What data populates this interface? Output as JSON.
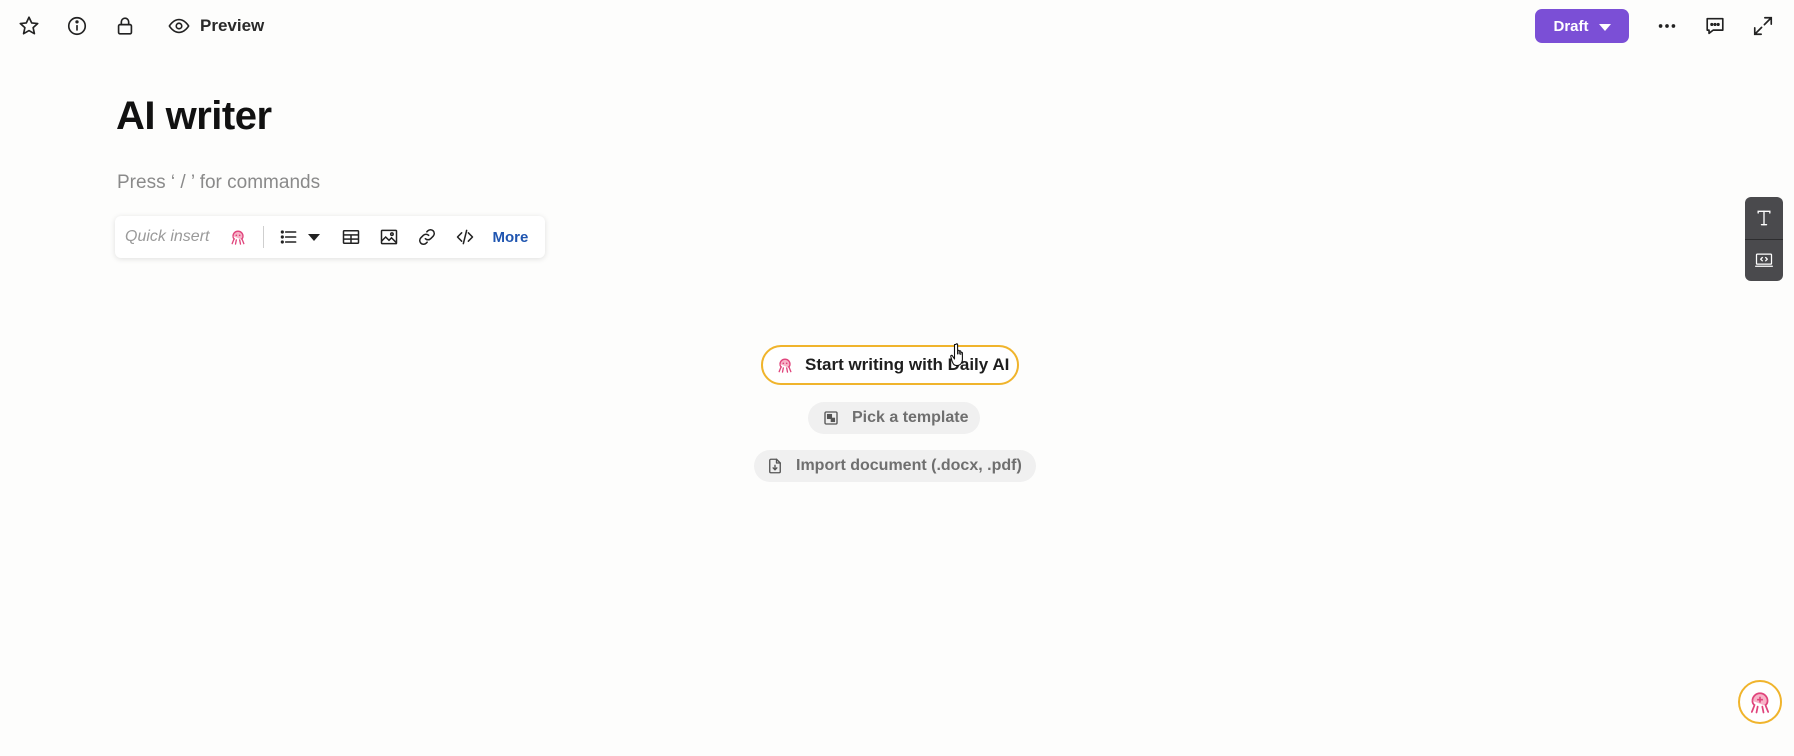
{
  "header": {
    "preview_label": "Preview",
    "draft_label": "Draft",
    "icons": [
      "star-icon",
      "info-icon",
      "lock-icon",
      "eye-icon",
      "more-horizontal-icon",
      "comment-icon",
      "expand-icon"
    ]
  },
  "document": {
    "title": "AI writer",
    "hint": "Press ‘ / ’ for commands"
  },
  "quick_insert": {
    "label": "Quick insert",
    "more_label": "More",
    "icons": [
      "octopus-ai-icon",
      "bulleted-list-icon",
      "table-icon",
      "image-icon",
      "link-icon",
      "code-icon"
    ]
  },
  "actions": {
    "ai_start_label": "Start writing with Daily AI",
    "template_label": "Pick a template",
    "import_label": "Import document (.docx, .pdf)"
  },
  "side_tools": {
    "icons": [
      "text-format-icon",
      "embed-icon"
    ]
  },
  "colors": {
    "accent": "#7b4fd6",
    "ai_ring": "#f0b42c",
    "ai_icon": "#e0447c",
    "link": "#1f55b0"
  }
}
